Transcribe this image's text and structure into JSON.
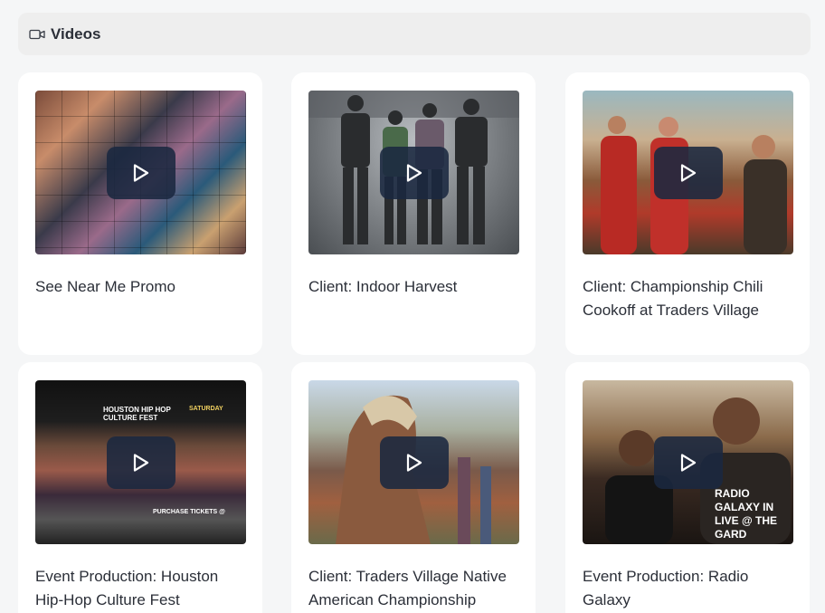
{
  "section": {
    "title": "Videos",
    "icon": "video-camera-icon"
  },
  "videos": [
    {
      "title": "See Near Me Promo",
      "thumbnail": "collage-of-faces"
    },
    {
      "title": "Client: Indoor Harvest",
      "thumbnail": "four-men-in-warehouse"
    },
    {
      "title": "Client: Championship Chili Cookoff at Traders Village",
      "thumbnail": "men-at-outdoor-event"
    },
    {
      "title": "Event Production: Houston Hip-Hop Culture Fest",
      "thumbnail": "hip-hop-fest-poster",
      "overlay": {
        "line1": "HOUSTON HIP HOP",
        "line2": "CULTURE FEST",
        "date": "SATURDAY",
        "tickets": "PURCHASE TICKETS @"
      }
    },
    {
      "title": "Client: Traders Village Native American Championship",
      "thumbnail": "native-american-dancer"
    },
    {
      "title": "Event Production: Radio Galaxy",
      "thumbnail": "two-men-at-event",
      "overlay": {
        "line1": "RADIO GALAXY IN",
        "line2": "LIVE @ THE GARD"
      }
    }
  ],
  "play_icon": "play-icon"
}
